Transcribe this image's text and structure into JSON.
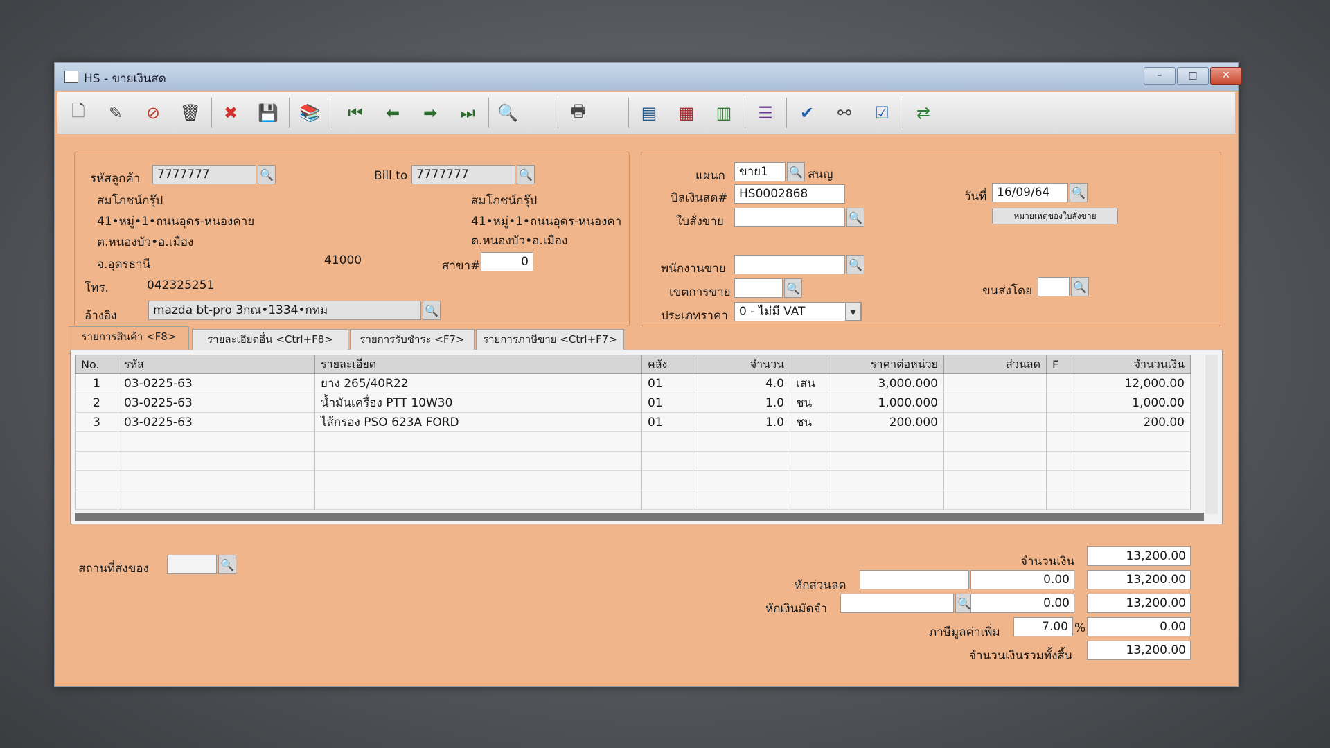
{
  "window": {
    "title": "HS - ขายเงินสด",
    "controls": {
      "minimize": "–",
      "maximize": "□",
      "close": "✕"
    }
  },
  "toolbar": {
    "buttons": [
      {
        "icon": "new-document-icon",
        "glyph": "🗋"
      },
      {
        "icon": "edit-icon",
        "glyph": "✎"
      },
      {
        "icon": "void-icon",
        "glyph": "⊘"
      },
      {
        "icon": "trash-icon",
        "glyph": "🗑"
      },
      {
        "icon": "cancel-icon",
        "glyph": "✖"
      },
      {
        "icon": "save-icon",
        "glyph": "💾"
      },
      {
        "icon": "copy-icon",
        "glyph": "📚"
      },
      {
        "icon": "first-record-icon",
        "glyph": "⏮"
      },
      {
        "icon": "previous-record-icon",
        "glyph": "⬅"
      },
      {
        "icon": "next-record-icon",
        "glyph": "➡"
      },
      {
        "icon": "last-record-icon",
        "glyph": "⏭"
      },
      {
        "icon": "search-icon",
        "glyph": "🔍"
      },
      {
        "icon": "print-icon",
        "glyph": "🖶"
      },
      {
        "icon": "screen-icon",
        "glyph": "▤"
      },
      {
        "icon": "form-icon",
        "glyph": "▦"
      },
      {
        "icon": "chart-icon",
        "glyph": "▥"
      },
      {
        "icon": "report-icon",
        "glyph": "☰"
      },
      {
        "icon": "approve-icon",
        "glyph": "✔"
      },
      {
        "icon": "link-icon",
        "glyph": "⚯"
      },
      {
        "icon": "ok-icon",
        "glyph": "☑"
      },
      {
        "icon": "transfer-icon",
        "glyph": "⇄"
      }
    ]
  },
  "customer": {
    "code_label": "รหัสลูกค้า",
    "code_value": "7777777",
    "bill_to_label": "Bill to",
    "bill_to_value": "7777777",
    "name": "สมโภชน์กรุ๊ป",
    "address1": "41•หมู่•1•ถนนอุดร-หนองคาย",
    "address2": "ต.หนองบัว•อ.เมือง",
    "address3": "จ.อุดรธานี",
    "postcode": "41000",
    "bill_name": "สมโภชน์กรุ๊ป",
    "bill_address1": "41•หมู่•1•ถนนอุดร-หนองคา",
    "bill_address2": "ต.หนองบัว•อ.เมือง",
    "branch_label": "สาขา#",
    "branch_value": "0",
    "phone_label": "โทร.",
    "phone_value": "042325251",
    "ref_label": "อ้างอิง",
    "ref_value": "mazda bt-pro 3กณ•1334•กทม"
  },
  "doc": {
    "dept_label": "แผนก",
    "dept_value": "ขาย1",
    "dept_name": "สนญ",
    "bill_no_label": "บิลเงินสด#",
    "bill_no_value": "HS0002868",
    "order_label": "ใบสั่งขาย",
    "order_value": "",
    "date_label": "วันที่",
    "date_value": "16/09/64",
    "order_note_button": "หมายเหตุของใบสั่งขาย",
    "salesperson_label": "พนักงานขาย",
    "salesperson_value": "",
    "area_label": "เขตการขาย",
    "area_value": "",
    "ship_by_label": "ขนส่งโดย",
    "ship_by_value": "",
    "price_type_label": "ประเภทราคา",
    "price_type_value": "0 - ไม่มี VAT"
  },
  "tabs": [
    {
      "label": "รายการสินค้า <F8>"
    },
    {
      "label": "รายละเอียดอื่น <Ctrl+F8>"
    },
    {
      "label": "รายการรับชำระ <F7>"
    },
    {
      "label": "รายการภาษีขาย <Ctrl+F7>"
    }
  ],
  "grid": {
    "columns": [
      "No.",
      "รหัส",
      "รายละเอียด",
      "คลัง",
      "จำนวน",
      "",
      "ราคาต่อหน่วย",
      "ส่วนลด",
      "F",
      "จำนวนเงิน"
    ],
    "rows": [
      {
        "no": "1",
        "code": "03-0225-63",
        "desc": "ยาง 265/40R22",
        "wh": "01",
        "qty": "4.0",
        "unit": "เสน",
        "price": "3,000.000",
        "disc": "",
        "f": "",
        "amount": "12,000.00"
      },
      {
        "no": "2",
        "code": "03-0225-63",
        "desc": "น้ำมันเครื่อง PTT 10W30",
        "wh": "01",
        "qty": "1.0",
        "unit": "ชน",
        "price": "1,000.000",
        "disc": "",
        "f": "",
        "amount": "1,000.00"
      },
      {
        "no": "3",
        "code": "03-0225-63",
        "desc": "ไส้กรอง PSO 623A FORD",
        "wh": "01",
        "qty": "1.0",
        "unit": "ชน",
        "price": "200.000",
        "disc": "",
        "f": "",
        "amount": "200.00"
      }
    ]
  },
  "footer": {
    "delivery_label": "สถานที่ส่งของ",
    "delivery_value": "",
    "amount_label": "จำนวนเงิน",
    "amount_value": "13,200.00",
    "discount_label": "หักส่วนลด",
    "discount_text": "",
    "discount_amount": "0.00",
    "after_discount": "13,200.00",
    "deposit_label": "หักเงินมัดจำ",
    "deposit_text": "",
    "deposit_amount": "0.00",
    "after_deposit": "13,200.00",
    "vat_label": "ภาษีมูลค่าเพิ่ม",
    "vat_rate": "7.00",
    "vat_percent": "%",
    "vat_amount": "0.00",
    "total_label": "จำนวนเงินรวมทั้งสิ้น",
    "total_value": "13,200.00"
  }
}
